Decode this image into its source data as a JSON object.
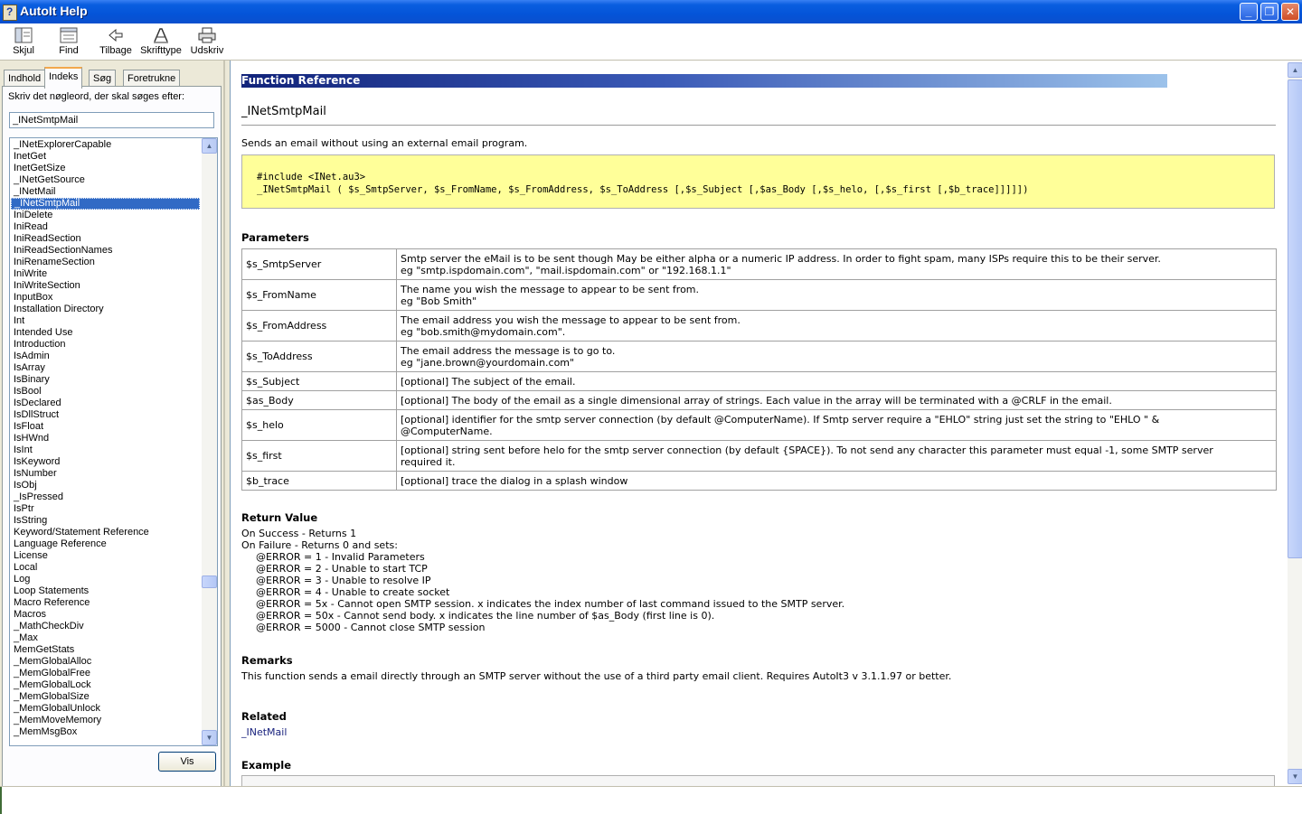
{
  "window": {
    "title": "AutoIt Help",
    "buttons": {
      "minimize": "_",
      "maximize": "❐",
      "close": "✕"
    }
  },
  "toolbar": {
    "hide": "Skjul",
    "find": "Find",
    "back": "Tilbage",
    "font": "Skrifttype",
    "print": "Udskriv"
  },
  "nav": {
    "tabs": [
      "Indhold",
      "Indeks",
      "Søg",
      "Foretrukne"
    ],
    "active_tab": "Indeks",
    "prompt": "Skriv det nøgleord, der skal søges efter:",
    "keyword_value": "_INetSmtpMail",
    "index_items": [
      "_INetExplorerCapable",
      "InetGet",
      "InetGetSize",
      "_INetGetSource",
      "_INetMail",
      "_INetSmtpMail",
      "IniDelete",
      "IniRead",
      "IniReadSection",
      "IniReadSectionNames",
      "IniRenameSection",
      "IniWrite",
      "IniWriteSection",
      "InputBox",
      "Installation Directory",
      "Int",
      "Intended Use",
      "Introduction",
      "IsAdmin",
      "IsArray",
      "IsBinary",
      "IsBool",
      "IsDeclared",
      "IsDllStruct",
      "IsFloat",
      "IsHWnd",
      "IsInt",
      "IsKeyword",
      "IsNumber",
      "IsObj",
      "_IsPressed",
      "IsPtr",
      "IsString",
      "Keyword/Statement Reference",
      "Language Reference",
      "License",
      "Local",
      "Log",
      "Loop Statements",
      "Macro Reference",
      "Macros",
      "_MathCheckDiv",
      "_Max",
      "MemGetStats",
      "_MemGlobalAlloc",
      "_MemGlobalFree",
      "_MemGlobalLock",
      "_MemGlobalSize",
      "_MemGlobalUnlock",
      "_MemMoveMemory",
      "_MemMsgBox"
    ],
    "selected_item": "_INetSmtpMail",
    "display_button": "Vis"
  },
  "content": {
    "banner": "Function Reference",
    "function_name": "_INetSmtpMail",
    "description": "Sends an email without using an external email program.",
    "syntax_line1": "#include <INet.au3>",
    "syntax_line2": "_INetSmtpMail ( $s_SmtpServer, $s_FromName, $s_FromAddress, $s_ToAddress [,$s_Subject [,$as_Body [,$s_helo, [,$s_first [,$b_trace]]]]])",
    "parameters_heading": "Parameters",
    "parameters": [
      {
        "name": "$s_SmtpServer",
        "line1": "Smtp server the eMail is to be sent though May be either alpha or a numeric IP address. In order to fight spam, many ISPs require this to be their server.",
        "line2": "eg \"smtp.ispdomain.com\", \"mail.ispdomain.com\" or \"192.168.1.1\""
      },
      {
        "name": "$s_FromName",
        "line1": "The name you wish the message to appear to be sent from.",
        "line2": "eg \"Bob Smith\""
      },
      {
        "name": "$s_FromAddress",
        "line1": "The email address you wish the message to appear to be sent from.",
        "line2": "eg \"bob.smith@mydomain.com\"."
      },
      {
        "name": "$s_ToAddress",
        "line1": "The email address the message is to go to.",
        "line2": "eg \"jane.brown@yourdomain.com\""
      },
      {
        "name": "$s_Subject",
        "line1": "[optional] The subject of the email.",
        "line2": ""
      },
      {
        "name": "$as_Body",
        "line1": "[optional] The body of the email as a single dimensional array of strings. Each value in the array will be terminated with a @CRLF in the email.",
        "line2": ""
      },
      {
        "name": "$s_helo",
        "line1": "[optional] identifier for the smtp server connection (by default @ComputerName). If Smtp server require a \"EHLO\" string just set the string to \"EHLO \" &",
        "line2": "@ComputerName."
      },
      {
        "name": "$s_first",
        "line1": "[optional] string sent before helo for the smtp server connection (by default {SPACE}). To not send any character this parameter must equal -1, some SMTP server",
        "line2": "required it."
      },
      {
        "name": "$b_trace",
        "line1": "[optional] trace the dialog in a splash window",
        "line2": ""
      }
    ],
    "return_heading": "Return Value",
    "return_lines": [
      "On Success - Returns 1",
      "On Failure - Returns 0 and sets:"
    ],
    "error_lines": [
      "@ERROR = 1 - Invalid Parameters",
      "@ERROR = 2 - Unable to start TCP",
      "@ERROR = 3 - Unable to resolve IP",
      "@ERROR = 4 - Unable to create socket",
      "@ERROR = 5x - Cannot open SMTP session. x indicates the index number of last command issued to the SMTP server.",
      "@ERROR = 50x - Cannot send body. x indicates the line number of $as_Body (first line is 0).",
      "@ERROR = 5000 - Cannot close SMTP session"
    ],
    "remarks_heading": "Remarks",
    "remarks_text": "This function sends a email directly through an SMTP server without the use of a third party email client. Requires AutoIt3 v 3.1.1.97 or better.",
    "related_heading": "Related",
    "related_link": "_INetMail",
    "example_heading": "Example"
  },
  "icons": {
    "hide": "hide-pane-icon",
    "find": "find-icon",
    "back": "back-arrow-icon",
    "font": "font-icon",
    "print": "printer-icon"
  },
  "colors": {
    "titlebar": "#0454d8",
    "selection": "#316ac5",
    "syntax_bg": "#ffff99",
    "banner_start": "#11237a",
    "banner_end": "#9cc2ea"
  }
}
